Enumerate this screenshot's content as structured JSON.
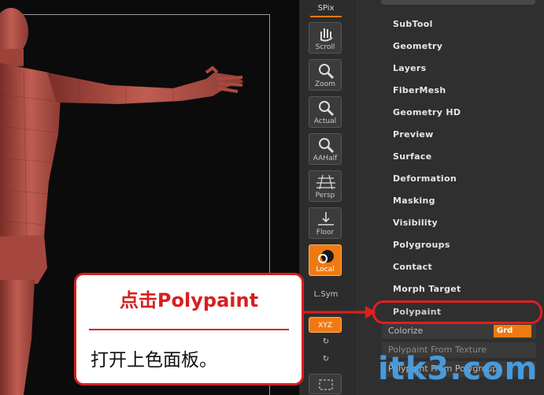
{
  "shelf": {
    "spix": "SPix",
    "buttons": [
      {
        "label": "Scroll"
      },
      {
        "label": "Zoom"
      },
      {
        "label": "Actual"
      },
      {
        "label": "AAHalf"
      },
      {
        "label": "Persp"
      },
      {
        "label": "Floor"
      },
      {
        "label": "Local"
      },
      {
        "label": "L.Sym"
      },
      {
        "label": "XYZ"
      }
    ]
  },
  "subtool_panel": {
    "menu": [
      "SubTool",
      "Geometry",
      "Layers",
      "FiberMesh",
      "Geometry HD",
      "Preview",
      "Surface",
      "Deformation",
      "Masking",
      "Visibility",
      "Polygroups",
      "Contact",
      "Morph Target",
      "Polypaint"
    ],
    "colorize_label": "Colorize",
    "grd_label": "Grd",
    "texture_label": "Polypaint From Texture",
    "polygroups_label": "Polypaint From Polygroups"
  },
  "callout": {
    "title": "点击Polypaint",
    "body": "打开上色面板。"
  },
  "watermark": "itk3.com",
  "colors": {
    "accent": "#f07a12",
    "callout_red": "#d81e1e",
    "figure": "#b5534a"
  }
}
